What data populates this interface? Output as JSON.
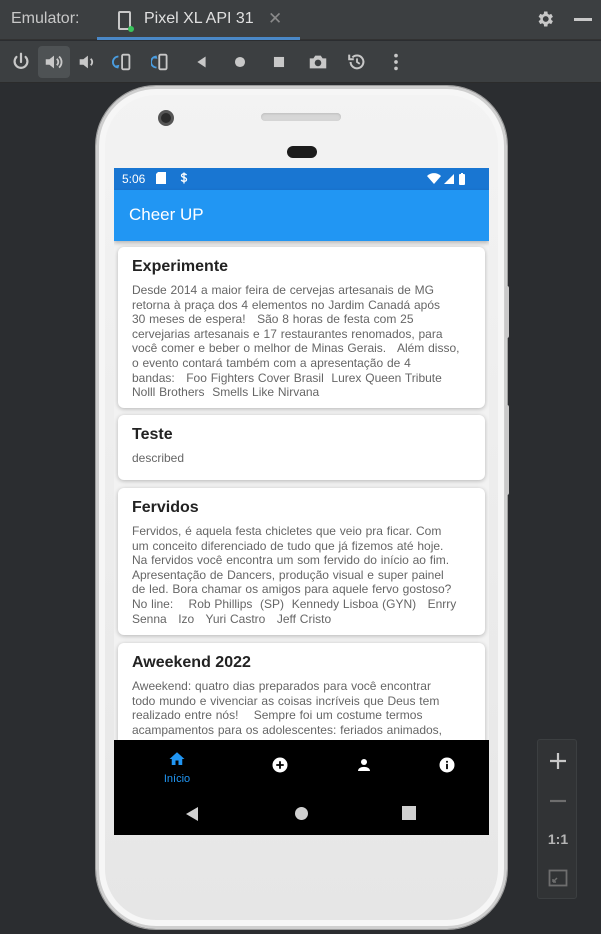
{
  "window": {
    "label": "Emulator:",
    "tab_title": "Pixel XL API 31",
    "close_glyph": "✕"
  },
  "toolbar": {
    "icons": [
      "power-icon",
      "volume-up-icon",
      "volume-down-icon",
      "rotate-left-icon",
      "rotate-right-icon",
      "back-icon",
      "home-icon",
      "overview-icon",
      "camera-icon",
      "snapshot-icon",
      "more-icon"
    ]
  },
  "statusbar": {
    "time": "5:06"
  },
  "app": {
    "title": "Cheer UP",
    "accent": "#2196f3",
    "status_color": "#1976d2"
  },
  "cards": [
    {
      "title": "Experimente",
      "body": "Desde 2014 a maior feira de cervejas artesanais de MG\nretorna à praça dos 4 elementos no Jardim Canadá após\n30 meses de espera!   São 8 horas de festa com 25\ncervejarias artesanais e 17 restaurantes renomados, para\nvocê comer e beber o melhor de Minas Gerais.   Além disso,\no evento contará também com a apresentação de 4\nbandas:   Foo Fighters Cover Brasil  Lurex Queen Tribute\nNolll Brothers  Smells Like Nirvana"
    },
    {
      "title": "Teste",
      "body": "described"
    },
    {
      "title": "Fervidos",
      "body": "Fervidos, é aquela festa chicletes que veio pra ficar. Com\num conceito diferenciado de tudo que já fizemos até hoje.\nNa fervidos você encontra um som fervido do início ao fim.\nApresentação de Dancers, produção visual e super painel\nde led. Bora chamar os amigos para aquele fervo gostoso?\nNo line:    Rob Phillips  (SP)  Kennedy Lisboa (GYN)   Enrry\nSenna   Izo   Yuri Castro   Jeff Cristo"
    },
    {
      "title": "Aweekend 2022",
      "body": "Aweekend: quatro dias preparados para você encontrar\ntodo mundo e vivenciar as coisas incríveis que Deus tem\nrealizado entre nós!    Sempre foi um costume termos\nacampamentos para os adolescentes: feriados animados,"
    }
  ],
  "bottom_nav": {
    "items": [
      {
        "icon": "home-icon",
        "label": "Início",
        "active": true
      },
      {
        "icon": "add-circle-icon",
        "label": ""
      },
      {
        "icon": "person-icon",
        "label": ""
      },
      {
        "icon": "info-icon",
        "label": ""
      }
    ]
  },
  "zoom_panel": {
    "one_to_one": "1:1"
  }
}
